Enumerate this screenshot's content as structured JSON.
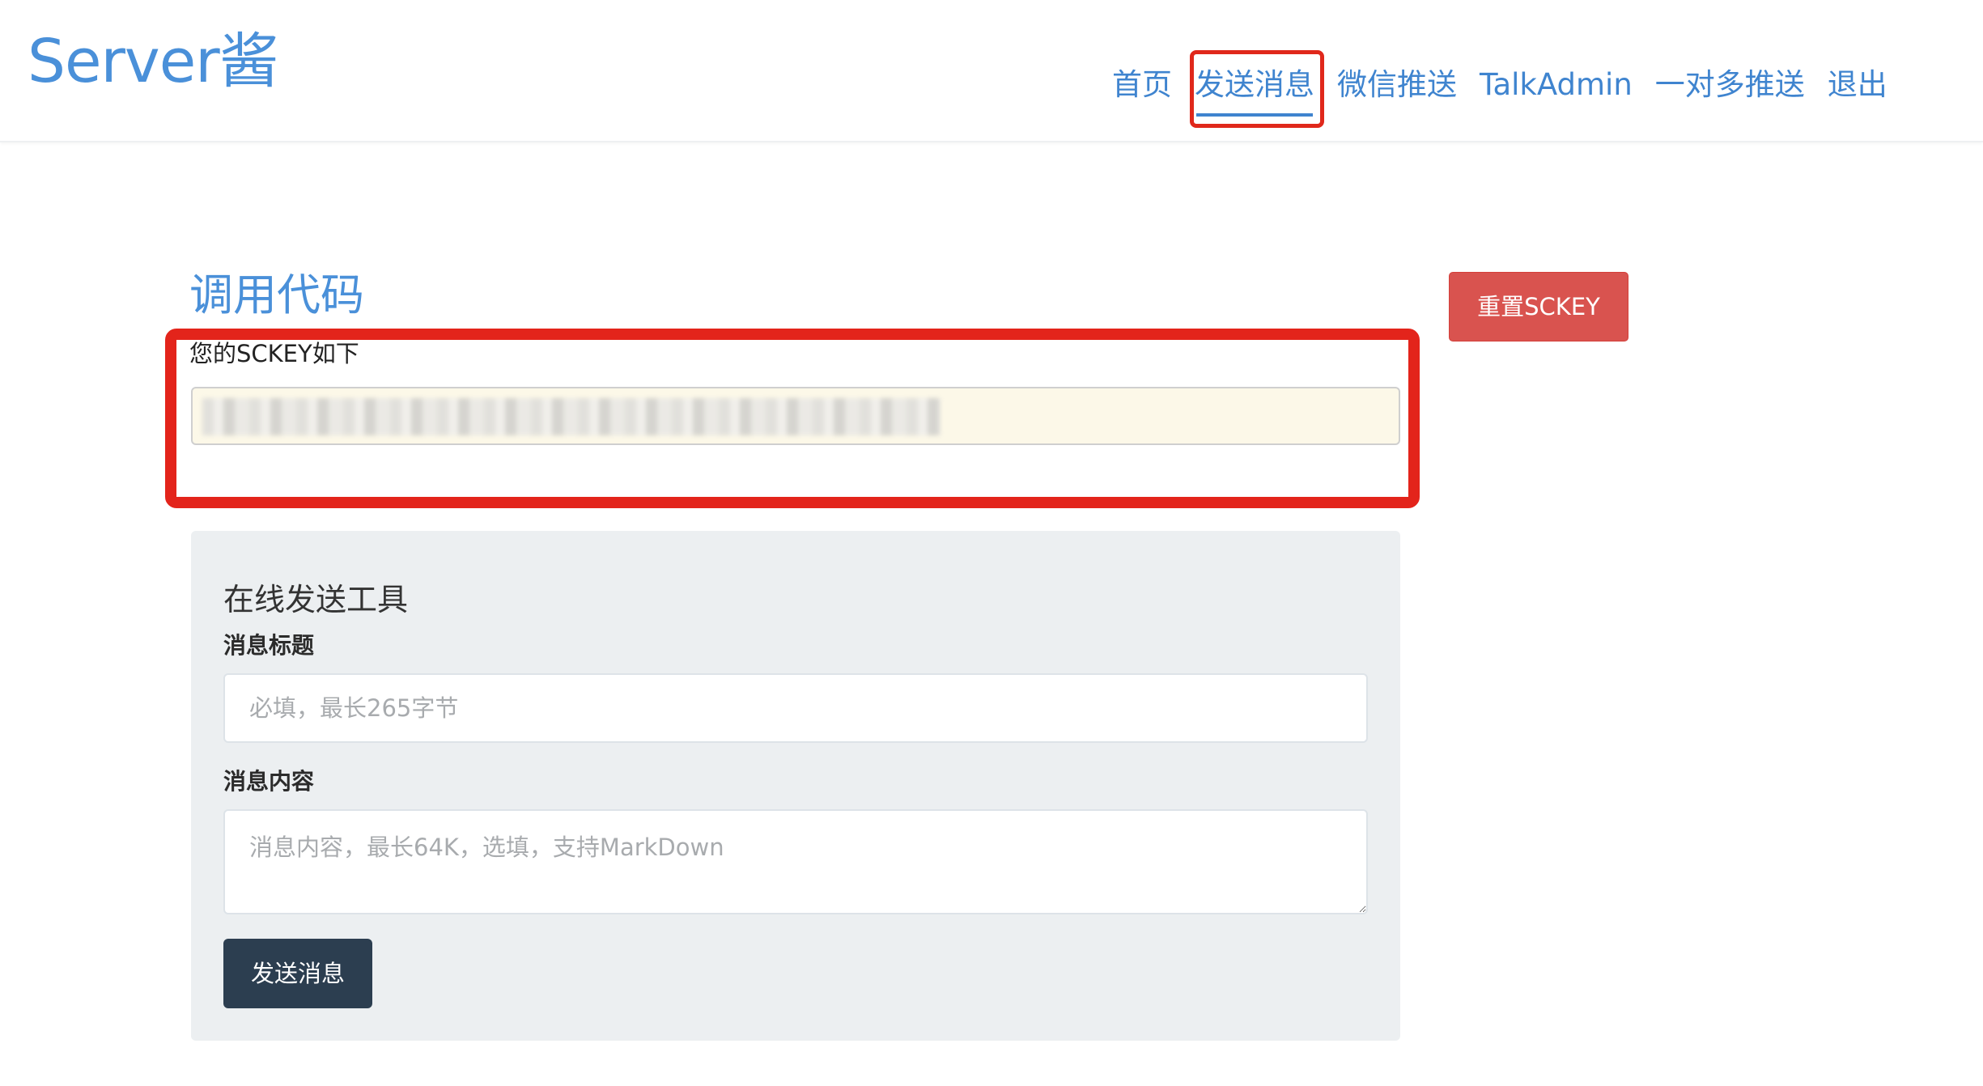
{
  "header": {
    "brand": "Server酱",
    "nav": [
      {
        "label": "首页",
        "active": false
      },
      {
        "label": "发送消息",
        "active": true
      },
      {
        "label": "微信推送",
        "active": false
      },
      {
        "label": "TalkAdmin",
        "active": false
      },
      {
        "label": "一对多推送",
        "active": false
      },
      {
        "label": "退出",
        "active": false
      }
    ]
  },
  "main": {
    "section_title": "调用代码",
    "reset_button": "重置SCKEY",
    "key_label": "您的SCKEY如下"
  },
  "tool": {
    "title": "在线发送工具",
    "title_label": "消息标题",
    "title_placeholder": "必填，最长265字节",
    "content_label": "消息内容",
    "content_placeholder": "消息内容，最长64K，选填，支持MarkDown",
    "send_button": "发送消息"
  },
  "colors": {
    "link": "#3f84cf",
    "danger": "#d9534f",
    "dark_button": "#2c3e50",
    "highlight": "#e3241b",
    "key_field_bg": "#fcf8e8"
  }
}
